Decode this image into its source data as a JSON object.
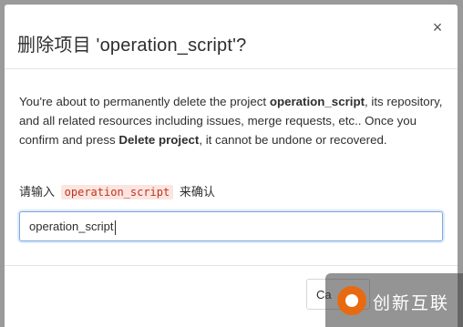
{
  "dialog": {
    "title": "删除项目 'operation_script'?",
    "close_label": "×",
    "description": {
      "part1": "You're about to permanently delete the project ",
      "project_name": "operation_script",
      "part2": ", its repository, and all related resources including issues, merge requests, etc.. Once you confirm and press ",
      "action": "Delete project",
      "part3": ", it cannot be undone or recovered."
    },
    "confirm": {
      "prefix": "请输入",
      "code": "operation_script",
      "suffix": "来确认"
    },
    "input_value": "operation_script",
    "cancel_label": "Ca"
  },
  "watermark": {
    "text": "创新互联"
  }
}
